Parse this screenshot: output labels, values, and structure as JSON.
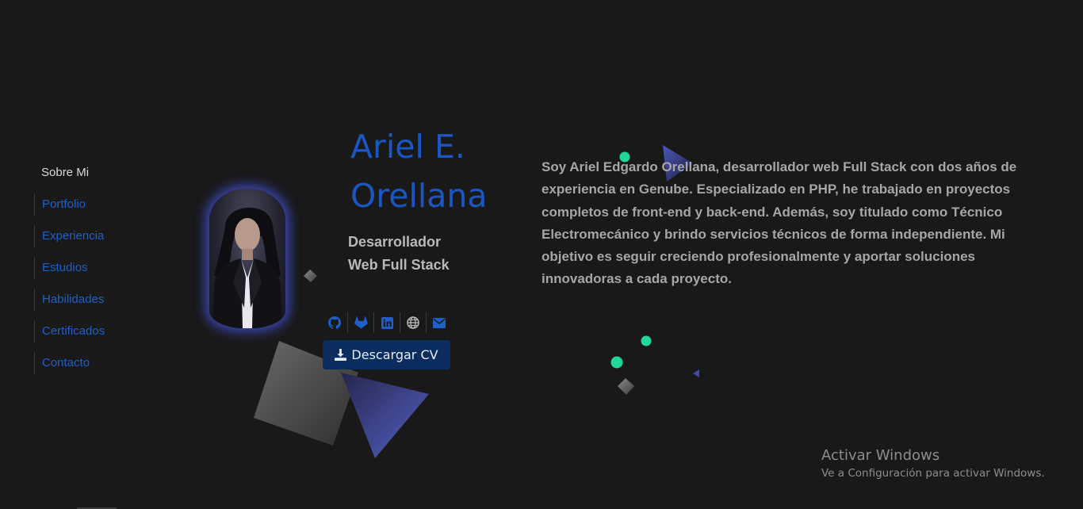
{
  "nav": {
    "items": [
      {
        "label": "Sobre Mi",
        "active": true
      },
      {
        "label": "Portfolio"
      },
      {
        "label": "Experiencia"
      },
      {
        "label": "Estudios"
      },
      {
        "label": "Habilidades"
      },
      {
        "label": "Certificados"
      },
      {
        "label": "Contacto"
      }
    ]
  },
  "profile": {
    "name_line1": "Ariel E.",
    "name_line2": "Orellana",
    "role_line1": "Desarrollador",
    "role_line2": "Web Full Stack"
  },
  "socials": [
    {
      "icon": "github-icon"
    },
    {
      "icon": "gitlab-icon"
    },
    {
      "icon": "linkedin-icon"
    },
    {
      "icon": "globe-icon"
    },
    {
      "icon": "envelope-icon"
    }
  ],
  "cv_button": {
    "label": "Descargar CV",
    "icon": "download-icon"
  },
  "bio": "Soy Ariel Edgardo Orellana, desarrollador web Full Stack con dos años de experiencia en Genube. Especializado en PHP, he trabajado en proyectos completos de front-end y back-end. Además, soy titulado como Técnico Electromecánico y brindo servicios técnicos de forma independiente. Mi objetivo es seguir creciendo profesionalmente y aportar soluciones innovadoras a cada proyecto.",
  "windows_watermark": {
    "title": "Activar Windows",
    "subtitle": "Ve a Configuración para activar Windows."
  },
  "colors": {
    "background": "#19191a",
    "accent_blue": "#1b56c3",
    "button_bg": "#0a2c5e",
    "dot_green": "#21d69a",
    "triangle_indigo": "#4c57b5"
  }
}
